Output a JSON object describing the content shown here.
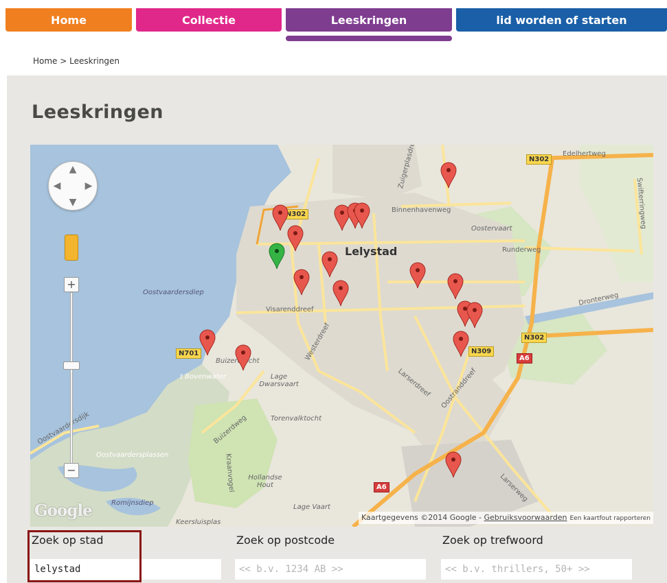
{
  "nav": {
    "tabs": [
      {
        "label": "Home",
        "color": "#f07f1f"
      },
      {
        "label": "Collectie",
        "color": "#e0288a"
      },
      {
        "label": "Leeskringen",
        "color": "#7f3d8f",
        "active": true
      },
      {
        "label": "lid worden of starten",
        "color": "#1a5fa7"
      }
    ]
  },
  "breadcrumb": "Home > Leeskringen",
  "page": {
    "title": "Leeskringen"
  },
  "map": {
    "city_label": "Lelystad",
    "labels": {
      "binnenhavenweg": "Binnenhavenweg",
      "oostervaart": "Oostervaart",
      "runderweg": "Runderweg",
      "oostvaardersdiep": "Oostvaardersdiep",
      "visarenddreef": "Visarenddreef",
      "westerdreef": "Westerdreef",
      "buizerdtocht": "Buizerdtocht",
      "bovenwater": "t Bovenwater",
      "lage_dwarsvaart": "Lage Dwarsvaart",
      "torenvalktocht": "Torenvalktocht",
      "buizerdweg": "Buizerdweg",
      "oostvaardersplassen": "Oostvaardersplassen",
      "hollandse_hout": "Hollandse Hout",
      "romijnsdiep": "Romijnsdiep",
      "lage_vaart": "Lage Vaart",
      "keersluisplas": "Keersluisplas",
      "edelhertweg": "Edelhertweg",
      "dronterweg": "Dronterweg",
      "larserdreef": "Larserdreef",
      "oostranddreef": "Oostranddreef",
      "larserweg": "Larserweg",
      "oostvaardersdijk": "Oostvaardersdijk",
      "zuigerplasdreef": "Zuigerplasdreef",
      "swifterringweg": "Swifterringweg",
      "kraanvogel": "Kraanvogel"
    },
    "road_badges": {
      "n302_top": "N302",
      "n302_left": "N302",
      "n302_right": "N302",
      "n701": "N701",
      "n309": "N309",
      "a6_right": "A6",
      "a6_bottom": "A6"
    },
    "logo": "Google",
    "attribution": "Kaartgegevens ©2014 Google - ",
    "terms_link": "Gebruiksvoorwaarden",
    "report_link": "Een kaartfout rapporteren",
    "marker_count": 21,
    "colors": {
      "water": "#a7c3dd",
      "land": "#e9e6dc",
      "urban": "#dedad0",
      "green": "#cfe3b3",
      "major_road": "#f6b24a",
      "road": "#fbe59a",
      "marker": "#e8574d",
      "marker_selected": "#35b445"
    }
  },
  "search": {
    "city": {
      "label": "Zoek op stad",
      "value": "lelystad"
    },
    "postcode": {
      "label": "Zoek op postcode",
      "placeholder": "<< b.v. 1234 AB >>"
    },
    "keyword": {
      "label": "Zoek op trefwoord",
      "placeholder": "<< b.v. thrillers, 50+ >>"
    }
  }
}
